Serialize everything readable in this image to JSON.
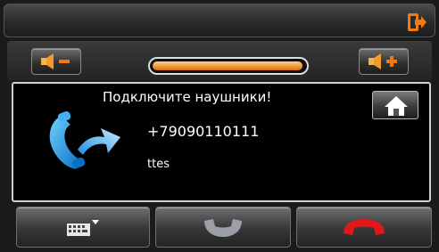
{
  "header": {
    "exit_icon": "exit-icon",
    "accent": "#f07a1a"
  },
  "volume": {
    "down_icon": "volume-down-icon",
    "up_icon": "volume-up-icon",
    "level": 0.99
  },
  "call": {
    "message": "Подключите наушники!",
    "phone_number": "+79090110111",
    "contact_name": "ttes",
    "call_icon": "incoming-call-icon",
    "home_icon": "home-icon"
  },
  "actions": {
    "keyboard_icon": "keyboard-icon",
    "answer_icon": "answer-call-icon",
    "hangup_icon": "hang-up-icon",
    "hangup_color": "#e0181a",
    "answer_color": "#9aa0a6"
  }
}
